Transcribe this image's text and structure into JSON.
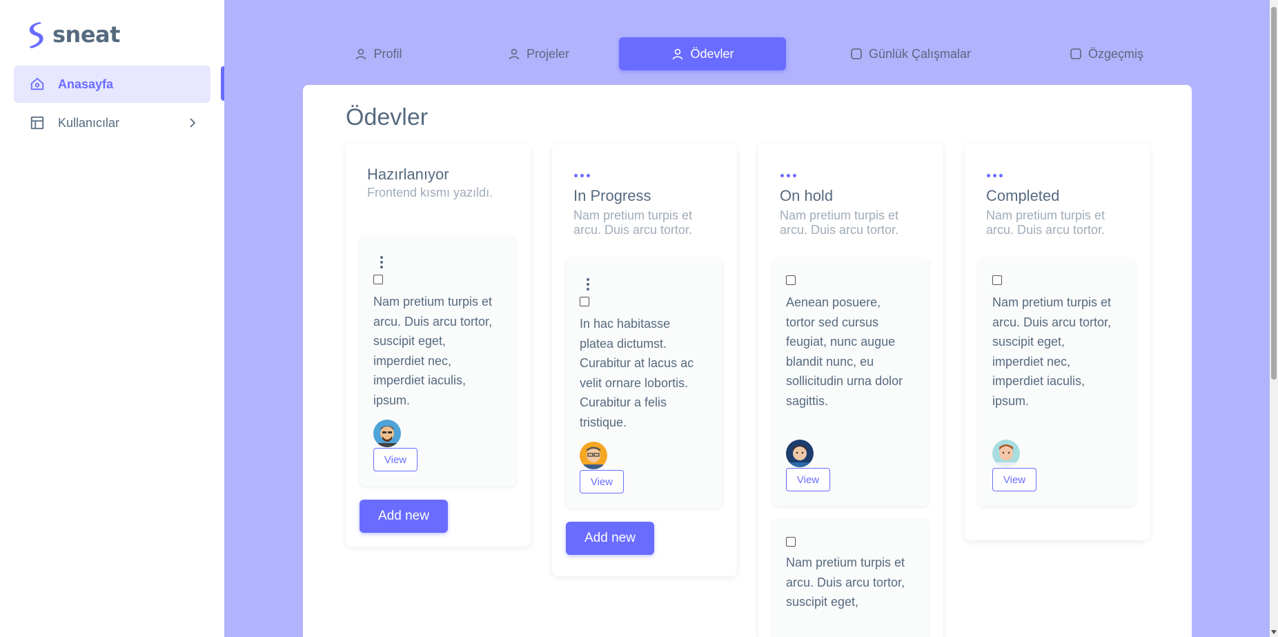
{
  "brand": {
    "name": "sneat",
    "accent": "#696cff"
  },
  "sidebar": {
    "items": [
      {
        "label": "Anasayfa",
        "icon": "home-icon",
        "active": true
      },
      {
        "label": "Kullanıcılar",
        "icon": "layout-icon",
        "active": false
      }
    ]
  },
  "tabs": [
    {
      "label": "Profil",
      "icon": "user-icon",
      "active": false
    },
    {
      "label": "Projeler",
      "icon": "user-icon",
      "active": false
    },
    {
      "label": "Ödevler",
      "icon": "user-icon",
      "active": true
    },
    {
      "label": "Günlük Çalışmalar",
      "icon": "square-icon",
      "active": false
    },
    {
      "label": "Özgeçmiş",
      "icon": "square-icon",
      "active": false
    }
  ],
  "page": {
    "title": "Ödevler"
  },
  "columns": [
    {
      "title": "Hazırlanıyor",
      "subtitle": "Frontend kısmı yazıldı.",
      "card": {
        "text": "Nam pretium turpis et arcu. Duis arcu tortor, suscipit eget, imperdiet nec, imperdiet iaculis, ipsum.",
        "view_label": "View"
      },
      "add_label": "Add new"
    },
    {
      "title": "In Progress",
      "subtitle": "Nam pretium turpis et arcu. Duis arcu tortor.",
      "card": {
        "text": "In hac habitasse platea dictumst. Curabitur at lacus ac velit ornare lobortis. Curabitur a felis tristique.",
        "view_label": "View"
      },
      "add_label": "Add new"
    },
    {
      "title": "On hold",
      "subtitle": "Nam pretium turpis et arcu. Duis arcu tortor.",
      "card": {
        "text": "Aenean posuere, tortor sed cursus feugiat, nunc augue blandit nunc, eu sollicitudin urna dolor sagittis.",
        "view_label": "View"
      },
      "card2": {
        "text": "Nam pretium turpis et arcu. Duis arcu tortor, suscipit eget,"
      }
    },
    {
      "title": "Completed",
      "subtitle": "Nam pretium turpis et arcu. Duis arcu tortor.",
      "card": {
        "text": "Nam pretium turpis et arcu. Duis arcu tortor, suscipit eget, imperdiet nec, imperdiet iaculis, ipsum.",
        "view_label": "View"
      }
    }
  ]
}
